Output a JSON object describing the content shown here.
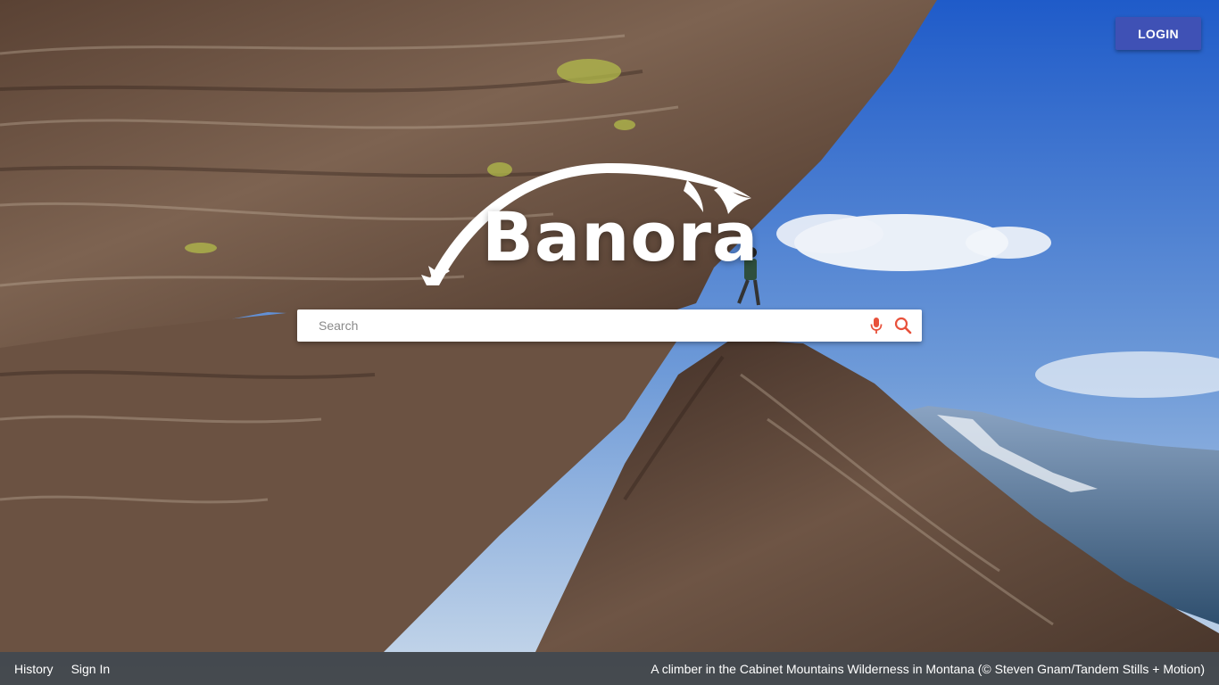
{
  "header": {
    "login_label": "LOGIN"
  },
  "logo": {
    "text": "Banora"
  },
  "search": {
    "placeholder": "Search",
    "value": "",
    "mic_icon": "microphone-icon",
    "search_icon": "magnifier-icon"
  },
  "footer": {
    "history_label": "History",
    "signin_label": "Sign In",
    "caption": "A climber in the Cabinet Mountains Wilderness in Montana (© Steven Gnam/Tandem Stills + Motion)"
  },
  "colors": {
    "login_button": "#3f51b5",
    "search_icons": "#e8513b",
    "footer_bar": "#141414"
  }
}
